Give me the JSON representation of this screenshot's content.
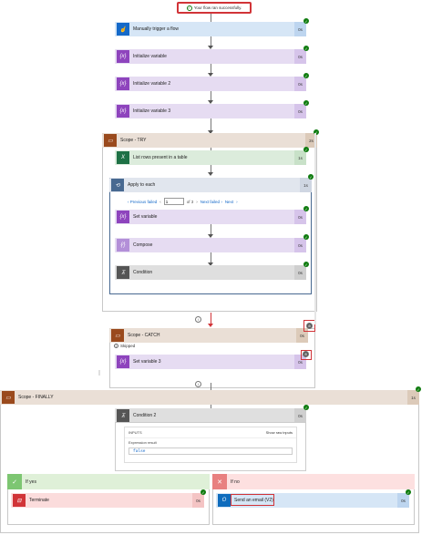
{
  "banner": {
    "text": "Your flow ran successfully."
  },
  "steps": {
    "trigger": {
      "label": "Manually trigger a flow",
      "duration": "0s"
    },
    "init1": {
      "label": "Initialize variable",
      "duration": "0s"
    },
    "init2": {
      "label": "Initialize variable 2",
      "duration": "0s"
    },
    "init3": {
      "label": "Initialize variable 3",
      "duration": "0s"
    },
    "scope_try": {
      "label": "Scope - TRY",
      "duration": "2s"
    },
    "list_rows": {
      "label": "List rows present in a table",
      "duration": "1s"
    },
    "apply_each": {
      "label": "Apply to each",
      "duration": "1s"
    },
    "set_var": {
      "label": "Set variable",
      "duration": "0s"
    },
    "compose": {
      "label": "Compose",
      "duration": "0s"
    },
    "condition": {
      "label": "Condition",
      "duration": "0s"
    },
    "scope_catch": {
      "label": "Scope - CATCH",
      "duration": "0s"
    },
    "skipped": {
      "label": "Skipped"
    },
    "set_var3": {
      "label": "Set variable 3",
      "duration": "0s"
    },
    "scope_finally": {
      "label": "Scope - FINALLY",
      "duration": "1s"
    },
    "condition2": {
      "label": "Condition 2",
      "duration": "0s"
    },
    "terminate": {
      "label": "Terminate",
      "duration": "0s"
    },
    "send_email": {
      "label": "Send an email (V2)",
      "duration": "0s"
    }
  },
  "pager": {
    "prev_failed": "Previous failed",
    "page_value": "1",
    "of_text": "of 3",
    "next_failed": "Next failed",
    "next": "Next"
  },
  "condition2_panel": {
    "inputs": "INPUTS",
    "show_raw": "Show raw inputs",
    "expr_label": "Expression result",
    "expr_value": "false"
  },
  "branches": {
    "yes": "If yes",
    "no": "If no"
  },
  "icons": {
    "success": "check-circle-icon",
    "variable": "variable-icon",
    "scope": "scope-icon",
    "loop": "loop-icon",
    "condition": "condition-icon",
    "compose": "compose-icon",
    "excel": "excel-icon",
    "trigger": "hand-icon",
    "terminate": "terminate-icon",
    "outlook": "outlook-icon",
    "add": "add-icon"
  },
  "colors": {
    "success": "#107c10",
    "highlight": "#d13438",
    "variable": "#8e44bd",
    "scope": "#9a4a1d"
  }
}
